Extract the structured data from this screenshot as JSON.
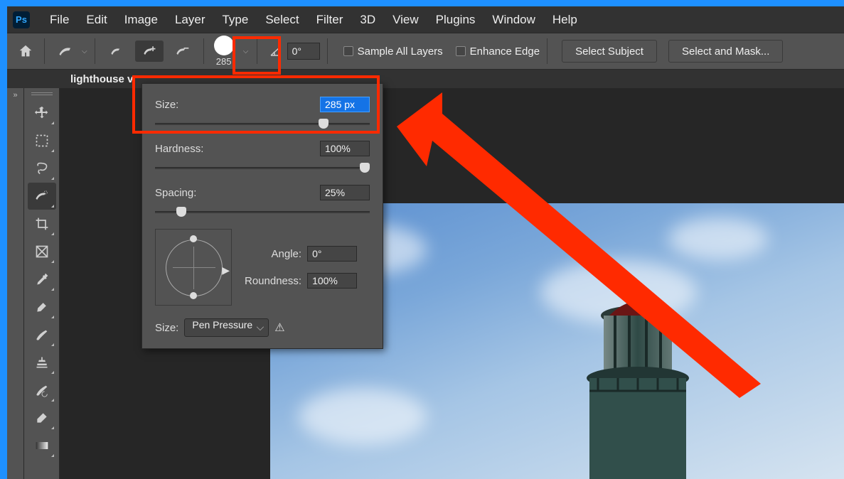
{
  "menu": [
    "File",
    "Edit",
    "Image",
    "Layer",
    "Type",
    "Select",
    "Filter",
    "3D",
    "View",
    "Plugins",
    "Window",
    "Help"
  ],
  "optbar": {
    "brush_size": "285",
    "angle": "0°",
    "sample_all": "Sample All Layers",
    "enhance": "Enhance Edge",
    "select_subject": "Select Subject",
    "select_mask": "Select and Mask..."
  },
  "tab": "lighthouse v",
  "popup": {
    "size_label": "Size:",
    "size_value": "285 px",
    "hardness_label": "Hardness:",
    "hardness_value": "100%",
    "spacing_label": "Spacing:",
    "spacing_value": "25%",
    "angle_label": "Angle:",
    "angle_value": "0°",
    "roundness_label": "Roundness:",
    "roundness_value": "100%",
    "size2_label": "Size:",
    "size2_value": "Pen Pressure"
  },
  "tools": [
    "move",
    "marquee",
    "lasso",
    "quick-select",
    "crop",
    "frame",
    "eyedropper",
    "healing",
    "brush",
    "stamp",
    "history-brush",
    "eraser",
    "gradient",
    "more"
  ]
}
